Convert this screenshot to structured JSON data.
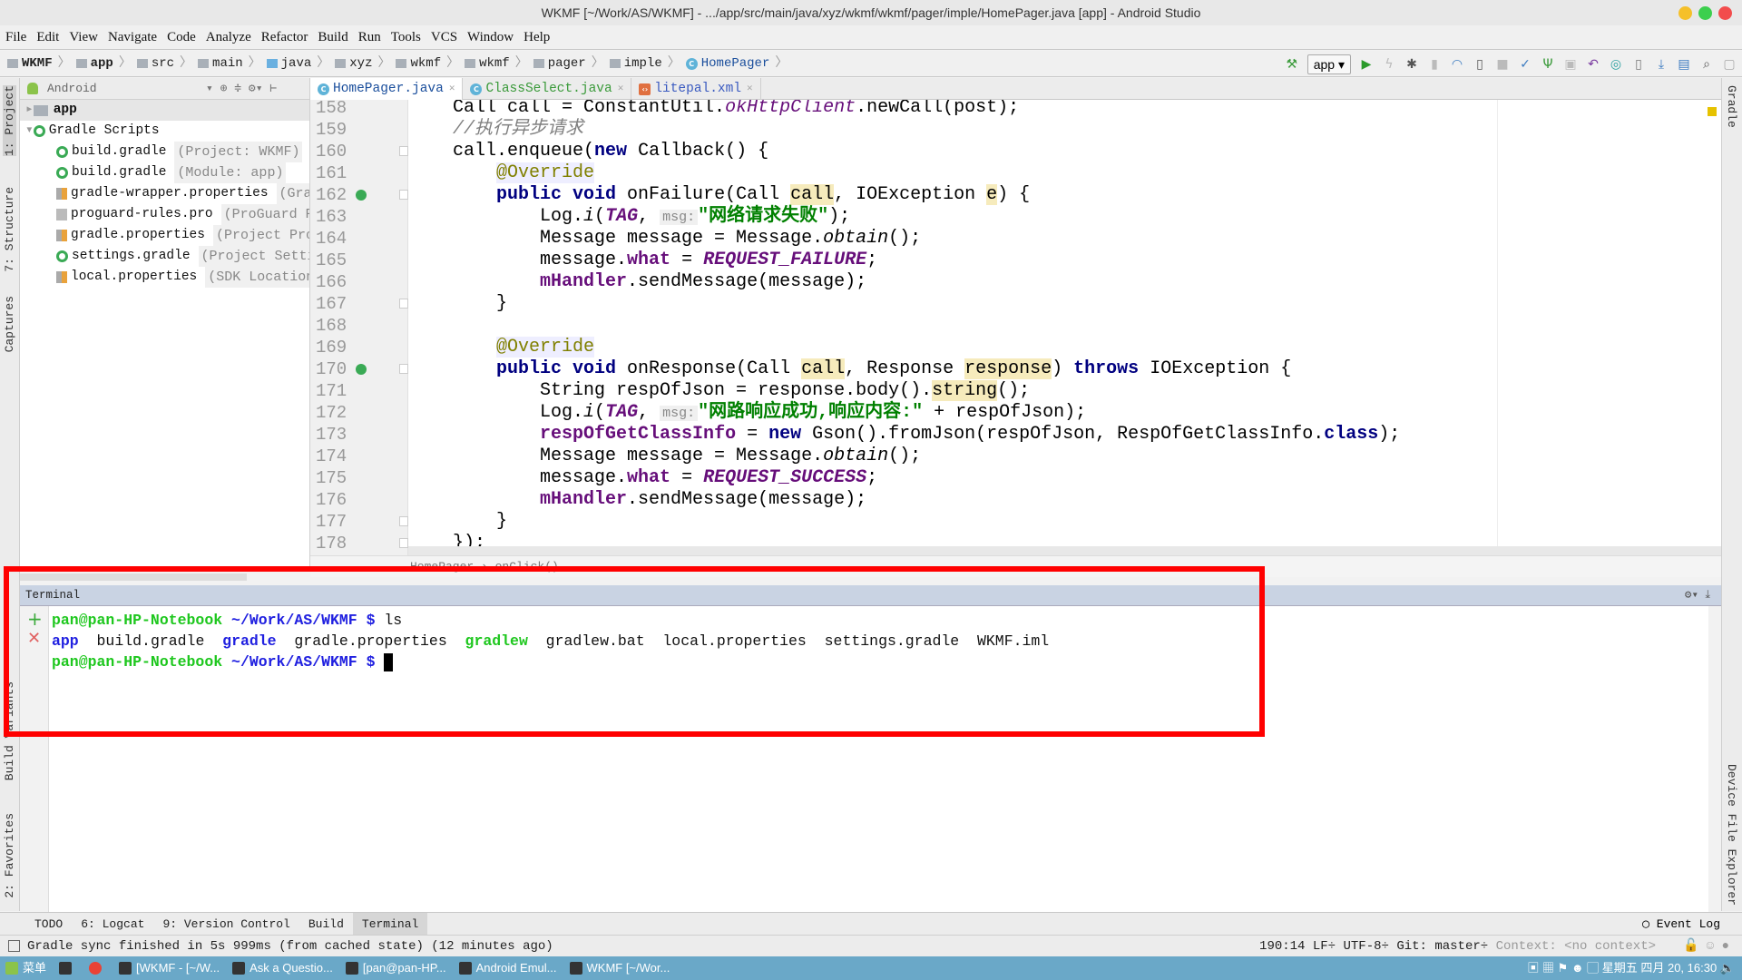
{
  "window": {
    "title": "WKMF [~/Work/AS/WKMF] - .../app/src/main/java/xyz/wkmf/wkmf/pager/imple/HomePager.java [app] - Android Studio"
  },
  "menu": [
    "File",
    "Edit",
    "View",
    "Navigate",
    "Code",
    "Analyze",
    "Refactor",
    "Build",
    "Run",
    "Tools",
    "VCS",
    "Window",
    "Help"
  ],
  "breadcrumb": [
    "WKMF",
    "app",
    "src",
    "main",
    "java",
    "xyz",
    "wkmf",
    "wkmf",
    "pager",
    "imple",
    "HomePager"
  ],
  "toolbar": {
    "run_config": "app"
  },
  "left_strip": [
    "1: Project",
    "7: Structure",
    "Captures",
    "Build Variants",
    "2: Favorites"
  ],
  "right_strip": [
    "Gradle",
    "Device File Explorer"
  ],
  "project": {
    "view": "Android",
    "items": [
      {
        "name": "app",
        "hint": "",
        "level": 0,
        "icon": "folder-icon"
      },
      {
        "name": "Gradle Scripts",
        "hint": "",
        "level": 0,
        "icon": "gradle-icon"
      },
      {
        "name": "build.gradle",
        "hint": "(Project: WKMF)",
        "level": 1,
        "icon": "gradle-icon"
      },
      {
        "name": "build.gradle",
        "hint": "(Module: app)",
        "level": 1,
        "icon": "gradle-icon"
      },
      {
        "name": "gradle-wrapper.properties",
        "hint": "(Gradle",
        "level": 1,
        "icon": "properties-icon"
      },
      {
        "name": "proguard-rules.pro",
        "hint": "(ProGuard Rules",
        "level": 1,
        "icon": "text-file-icon"
      },
      {
        "name": "gradle.properties",
        "hint": "(Project Properties",
        "level": 1,
        "icon": "properties-icon"
      },
      {
        "name": "settings.gradle",
        "hint": "(Project Settings",
        "level": 1,
        "icon": "gradle-icon"
      },
      {
        "name": "local.properties",
        "hint": "(SDK Location)",
        "level": 1,
        "icon": "properties-icon"
      }
    ]
  },
  "tabs": [
    {
      "label": "HomePager.java",
      "active": true
    },
    {
      "label": "ClassSelect.java",
      "active": false
    },
    {
      "label": "litepal.xml",
      "active": false
    }
  ],
  "code": [
    {
      "n": "158",
      "t": [
        [
          "    Call call = ConstantUtil.",
          ""
        ],
        [
          "okHttpClient",
          "si"
        ],
        [
          ".newCall(post);",
          ""
        ]
      ]
    },
    {
      "n": "159",
      "t": [
        [
          "    //执行异步请求",
          "cm"
        ]
      ]
    },
    {
      "n": "160",
      "fold": true,
      "t": [
        [
          "    call.enqueue(",
          ""
        ],
        [
          "new",
          "k"
        ],
        [
          " Callback() {",
          ""
        ]
      ]
    },
    {
      "n": "161",
      "t": [
        [
          "        ",
          ""
        ],
        [
          "@Override",
          "an"
        ]
      ]
    },
    {
      "n": "162",
      "ov": true,
      "fold": true,
      "t": [
        [
          "        ",
          ""
        ],
        [
          "public void",
          "k"
        ],
        [
          " onFailure(Call ",
          ""
        ],
        [
          "call",
          "hl"
        ],
        [
          ", IOException ",
          ""
        ],
        [
          "e",
          "hl"
        ],
        [
          ") {",
          ""
        ]
      ]
    },
    {
      "n": "163",
      "t": [
        [
          "            Log.",
          ""
        ],
        [
          "i",
          "it"
        ],
        [
          "(",
          ""
        ],
        [
          "TAG",
          "sf"
        ],
        [
          ", ",
          ""
        ],
        [
          "msg:",
          "hint"
        ],
        [
          "\"网络请求失败\"",
          "st"
        ],
        [
          ");",
          ""
        ]
      ]
    },
    {
      "n": "164",
      "t": [
        [
          "            Message message = Message.",
          ""
        ],
        [
          "obtain",
          "it"
        ],
        [
          "();",
          ""
        ]
      ]
    },
    {
      "n": "165",
      "t": [
        [
          "            message.",
          ""
        ],
        [
          "what",
          "fd"
        ],
        [
          " = ",
          ""
        ],
        [
          "REQUEST_FAILURE",
          "sf"
        ],
        [
          ";",
          ""
        ]
      ]
    },
    {
      "n": "166",
      "t": [
        [
          "            ",
          ""
        ],
        [
          "mHandler",
          "fd"
        ],
        [
          ".sendMessage(message);",
          ""
        ]
      ]
    },
    {
      "n": "167",
      "fold": true,
      "t": [
        [
          "        }",
          ""
        ]
      ]
    },
    {
      "n": "168",
      "t": []
    },
    {
      "n": "169",
      "t": [
        [
          "        ",
          ""
        ],
        [
          "@Override",
          "an"
        ]
      ]
    },
    {
      "n": "170",
      "ov": true,
      "fold": true,
      "t": [
        [
          "        ",
          ""
        ],
        [
          "public void",
          "k"
        ],
        [
          " onResponse(Call ",
          ""
        ],
        [
          "call",
          "hl"
        ],
        [
          ", Response ",
          ""
        ],
        [
          "response",
          "hl"
        ],
        [
          ") ",
          ""
        ],
        [
          "throws",
          "k"
        ],
        [
          " IOException {",
          ""
        ]
      ]
    },
    {
      "n": "171",
      "t": [
        [
          "            String respOfJson = response.body().",
          ""
        ],
        [
          "string",
          "hl"
        ],
        [
          "();",
          ""
        ]
      ]
    },
    {
      "n": "172",
      "t": [
        [
          "            Log.",
          ""
        ],
        [
          "i",
          "it"
        ],
        [
          "(",
          ""
        ],
        [
          "TAG",
          "sf"
        ],
        [
          ", ",
          ""
        ],
        [
          "msg:",
          "hint"
        ],
        [
          "\"网路响应成功,响应内容:\"",
          "st"
        ],
        [
          " + respOfJson);",
          ""
        ]
      ]
    },
    {
      "n": "173",
      "t": [
        [
          "            ",
          ""
        ],
        [
          "respOfGetClassInfo",
          "fd"
        ],
        [
          " = ",
          ""
        ],
        [
          "new",
          "k"
        ],
        [
          " Gson().fromJson(respOfJson, RespOfGetClassInfo.",
          ""
        ],
        [
          "class",
          "k"
        ],
        [
          ");",
          ""
        ]
      ]
    },
    {
      "n": "174",
      "t": [
        [
          "            Message message = Message.",
          ""
        ],
        [
          "obtain",
          "it"
        ],
        [
          "();",
          ""
        ]
      ]
    },
    {
      "n": "175",
      "t": [
        [
          "            message.",
          ""
        ],
        [
          "what",
          "fd"
        ],
        [
          " = ",
          ""
        ],
        [
          "REQUEST_SUCCESS",
          "sf"
        ],
        [
          ";",
          ""
        ]
      ]
    },
    {
      "n": "176",
      "t": [
        [
          "            ",
          ""
        ],
        [
          "mHandler",
          "fd"
        ],
        [
          ".sendMessage(message);",
          ""
        ]
      ]
    },
    {
      "n": "177",
      "fold": true,
      "t": [
        [
          "        }",
          ""
        ]
      ]
    },
    {
      "n": "178",
      "fold": true,
      "t": [
        [
          "    });",
          ""
        ]
      ]
    }
  ],
  "editor_breadcrumb": "HomePager › onClick()",
  "terminal": {
    "title": "Terminal",
    "prompt_user": "pan@pan-HP-Notebook",
    "prompt_path": "~/Work/AS/WKMF $",
    "command": "ls",
    "output": [
      [
        "app",
        "dir"
      ],
      [
        "build.gradle",
        "file"
      ],
      [
        "gradle",
        "dir"
      ],
      [
        "gradle.properties",
        "file"
      ],
      [
        "gradlew",
        "exec"
      ],
      [
        "gradlew.bat",
        "file"
      ],
      [
        "local.properties",
        "file"
      ],
      [
        "settings.gradle",
        "file"
      ],
      [
        "WKMF.iml",
        "file"
      ]
    ]
  },
  "bottom_tabs": [
    {
      "label": "TODO"
    },
    {
      "label": "6: Logcat"
    },
    {
      "label": "9: Version Control"
    },
    {
      "label": "Build"
    },
    {
      "label": "Terminal",
      "active": true
    }
  ],
  "event_log": "Event Log",
  "status": {
    "message": "Gradle sync finished in 5s 999ms (from cached state) (12 minutes ago)",
    "position": "190:14",
    "line_sep": "LF÷",
    "encoding": "UTF-8÷",
    "git": "Git: master÷",
    "context": "Context: <no context>"
  },
  "taskbar": {
    "menu": "菜单",
    "tasks": [
      "[WKMF - [~/W...",
      "Ask a Questio...",
      "[pan@pan-HP...",
      "Android Emul...",
      "WKMF [~/Wor..."
    ],
    "clock": "星期五 四月 20, 16:30"
  },
  "colors": {
    "highlight_box": "#ff0000",
    "taskbar": "#6aa8c8",
    "terminal_header": "#c9d3e3"
  }
}
